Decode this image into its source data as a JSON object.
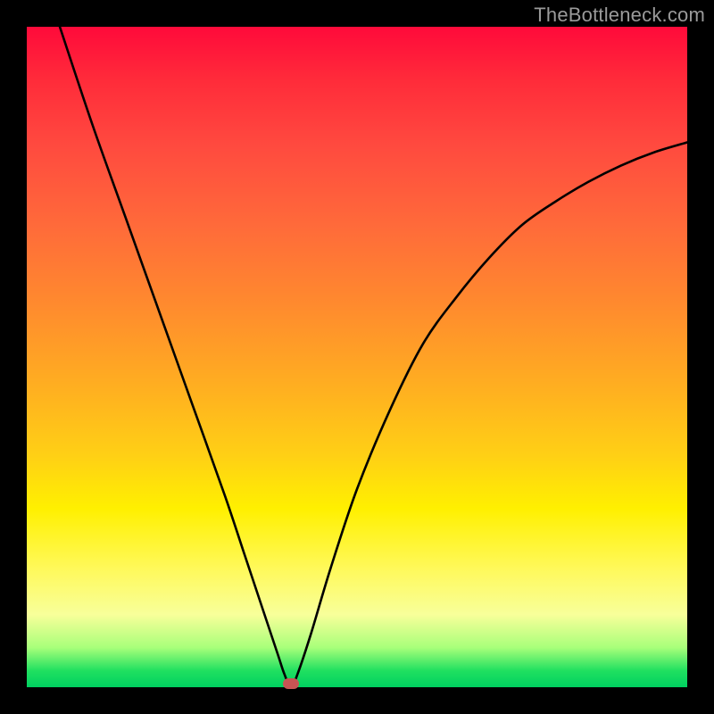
{
  "watermark": "TheBottleneck.com",
  "colors": {
    "frame_bg": "#000000",
    "curve": "#000000",
    "marker": "#c75454",
    "gradient_top": "#ff0a3a",
    "gradient_bottom": "#00d060"
  },
  "chart_data": {
    "type": "line",
    "title": "",
    "xlabel": "",
    "ylabel": "",
    "xlim": [
      0,
      100
    ],
    "ylim": [
      0,
      100
    ],
    "grid": false,
    "legend": false,
    "min_point": {
      "x": 40,
      "y": 0
    },
    "series": [
      {
        "name": "bottleneck_curve",
        "x": [
          5,
          10,
          15,
          20,
          25,
          30,
          33,
          36,
          38,
          39,
          40,
          41,
          43,
          46,
          50,
          55,
          60,
          65,
          70,
          75,
          80,
          85,
          90,
          95,
          100
        ],
        "y": [
          100,
          85,
          71,
          57,
          43,
          29,
          20,
          11,
          5,
          2,
          0,
          2,
          8,
          18,
          30,
          42,
          52,
          59,
          65,
          70,
          73.5,
          76.5,
          79,
          81,
          82.5
        ]
      }
    ]
  }
}
